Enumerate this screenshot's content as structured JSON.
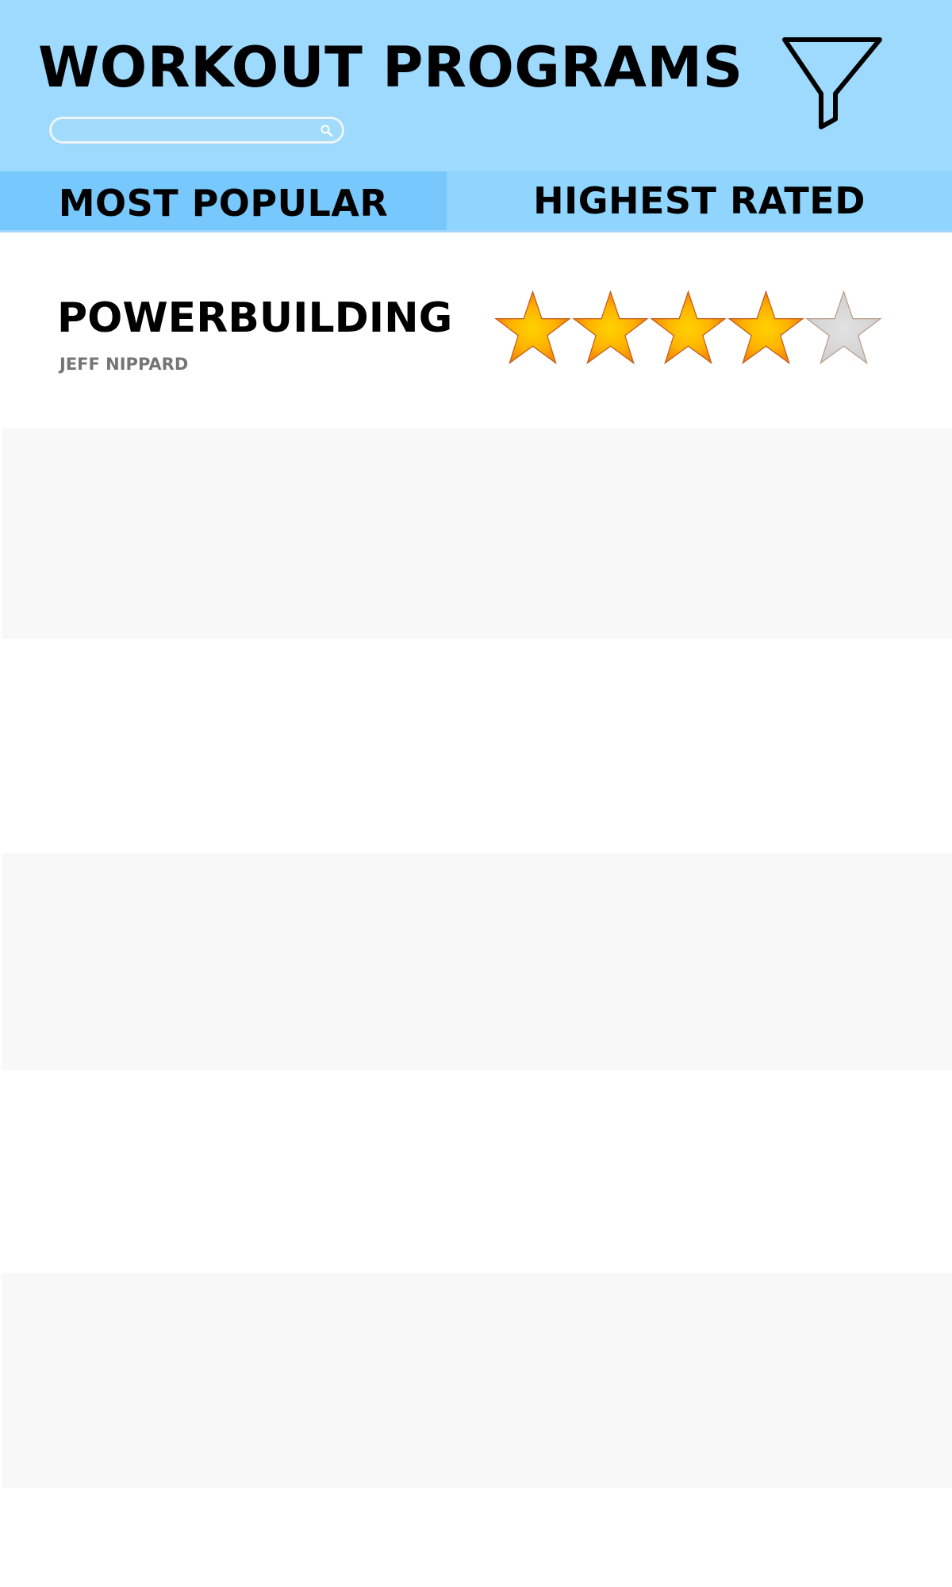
{
  "app": {
    "title": "WORKOUT PROGRAMS"
  },
  "search": {
    "value": "",
    "placeholder": "",
    "icon": "search-icon"
  },
  "filter": {
    "icon": "filter-funnel-icon"
  },
  "tabs": [
    {
      "label": "MOST POPULAR",
      "active": true
    },
    {
      "label": "HIGHEST RATED",
      "active": false
    }
  ],
  "programs": [
    {
      "name": "POWERBUILDING",
      "author": "JEFF NIPPARD",
      "rating": 4,
      "rating_max": 5
    },
    {
      "name": "",
      "author": ""
    },
    {
      "name": "",
      "author": ""
    },
    {
      "name": "",
      "author": ""
    },
    {
      "name": "",
      "author": ""
    },
    {
      "name": "",
      "author": ""
    },
    {
      "name": "",
      "author": ""
    }
  ],
  "colors": {
    "header_background": "#9ddafd",
    "tab_active": "#77c9fd",
    "tab_inactive": "#8fd5fd",
    "row_alt": "#f8f8f8",
    "star_filled": "#f7a20e",
    "star_empty": "#d4d4d4",
    "author_text": "#757575"
  }
}
